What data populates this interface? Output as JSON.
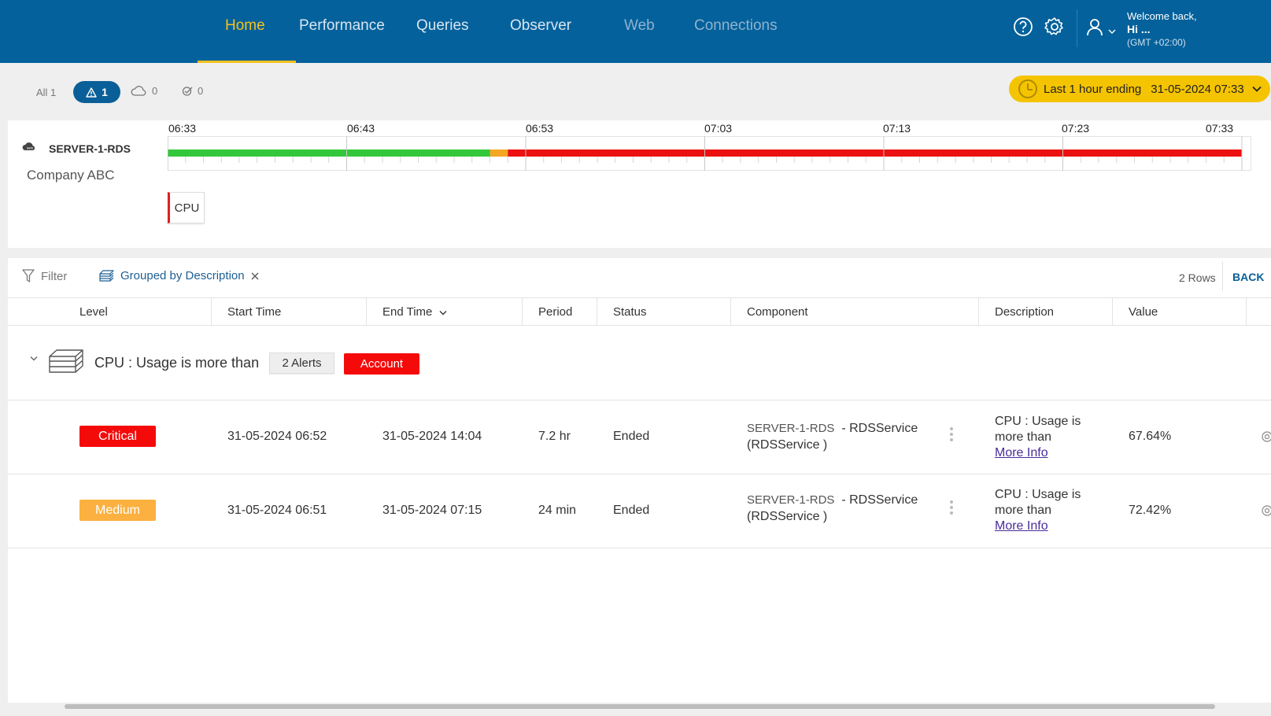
{
  "nav": {
    "items": [
      {
        "label": "Home",
        "state": "active"
      },
      {
        "label": "Performance",
        "state": "normal"
      },
      {
        "label": "Queries",
        "state": "normal"
      },
      {
        "label": "Observer",
        "state": "normal"
      },
      {
        "label": "Web",
        "state": "dim"
      },
      {
        "label": "Connections",
        "state": "dim"
      }
    ],
    "icons": [
      "help-icon",
      "settings-icon",
      "user-icon",
      "chevron-down-icon"
    ]
  },
  "user": {
    "welcome": "Welcome back,",
    "greeting": "Hi  ...",
    "timezone": "(GMT +02:00)"
  },
  "filters": {
    "all": "All 1",
    "alerts_count": "1",
    "cloud_count": "0",
    "resolved_count": "0"
  },
  "time_range": {
    "label": "Last 1 hour ending",
    "date": "31-05-2024 07:33"
  },
  "timeline": {
    "server": "SERVER-1-RDS",
    "company": "Company ABC",
    "ticks": [
      "06:33",
      "06:43",
      "06:53",
      "07:03",
      "07:13",
      "07:23",
      "07:33"
    ],
    "segments": [
      {
        "status": "ok",
        "from": "06:33",
        "to": "06:51"
      },
      {
        "status": "warning",
        "from": "06:51",
        "to": "06:52"
      },
      {
        "status": "critical",
        "from": "06:52",
        "to": "07:33"
      }
    ],
    "colors": {
      "ok": "#34c73b",
      "warning": "#f5a623",
      "critical": "#ec1111"
    },
    "tag": "CPU"
  },
  "toolbar": {
    "filter": "Filter",
    "grouped": "Grouped by Description",
    "rows": "2 Rows",
    "back": "BACK"
  },
  "table": {
    "headers": [
      "Level",
      "Start Time",
      "End Time",
      "Period",
      "Status",
      "Component",
      "Description",
      "Value"
    ],
    "group": {
      "title": "CPU : Usage is more than",
      "alerts": "2 Alerts",
      "tag": "Account"
    },
    "rows": [
      {
        "level": "Critical",
        "level_color": "#f50a0a",
        "start": "31-05-2024 06:52",
        "end": "31-05-2024 14:04",
        "period": "7.2 hr",
        "status": "Ended",
        "component_server": "SERVER-1-RDS",
        "component_rest": "- RDSService",
        "component_line2": "(RDSService )",
        "desc_line1": "CPU : Usage is",
        "desc_line2": "more than",
        "more": "More Info",
        "value": "67.64%"
      },
      {
        "level": "Medium",
        "level_color": "#fbb040",
        "start": "31-05-2024 06:51",
        "end": "31-05-2024 07:15",
        "period": "24 min",
        "status": "Ended",
        "component_server": "SERVER-1-RDS",
        "component_rest": "- RDSService",
        "component_line2": "(RDSService )",
        "desc_line1": "CPU : Usage is",
        "desc_line2": "more than",
        "more": "More Info",
        "value": "72.42%"
      }
    ]
  }
}
